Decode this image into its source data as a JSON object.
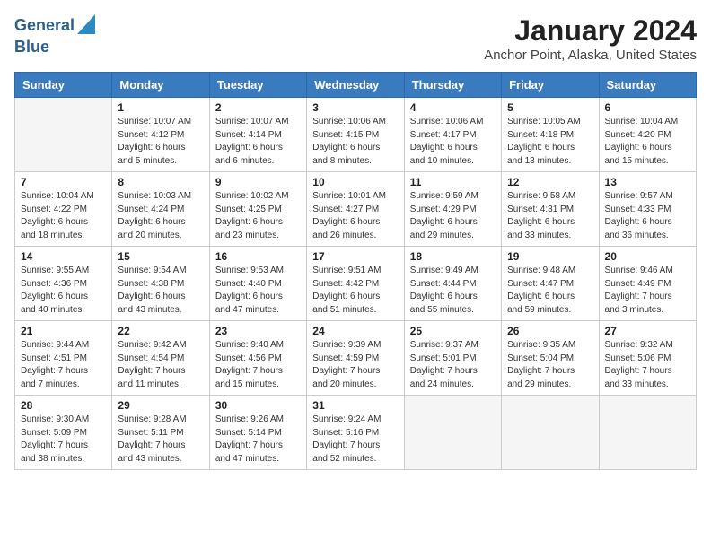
{
  "logo": {
    "line1": "General",
    "line2": "Blue"
  },
  "title": "January 2024",
  "subtitle": "Anchor Point, Alaska, United States",
  "headers": [
    "Sunday",
    "Monday",
    "Tuesday",
    "Wednesday",
    "Thursday",
    "Friday",
    "Saturday"
  ],
  "weeks": [
    [
      {
        "day": "",
        "info": ""
      },
      {
        "day": "1",
        "info": "Sunrise: 10:07 AM\nSunset: 4:12 PM\nDaylight: 6 hours\nand 5 minutes."
      },
      {
        "day": "2",
        "info": "Sunrise: 10:07 AM\nSunset: 4:14 PM\nDaylight: 6 hours\nand 6 minutes."
      },
      {
        "day": "3",
        "info": "Sunrise: 10:06 AM\nSunset: 4:15 PM\nDaylight: 6 hours\nand 8 minutes."
      },
      {
        "day": "4",
        "info": "Sunrise: 10:06 AM\nSunset: 4:17 PM\nDaylight: 6 hours\nand 10 minutes."
      },
      {
        "day": "5",
        "info": "Sunrise: 10:05 AM\nSunset: 4:18 PM\nDaylight: 6 hours\nand 13 minutes."
      },
      {
        "day": "6",
        "info": "Sunrise: 10:04 AM\nSunset: 4:20 PM\nDaylight: 6 hours\nand 15 minutes."
      }
    ],
    [
      {
        "day": "7",
        "info": "Sunrise: 10:04 AM\nSunset: 4:22 PM\nDaylight: 6 hours\nand 18 minutes."
      },
      {
        "day": "8",
        "info": "Sunrise: 10:03 AM\nSunset: 4:24 PM\nDaylight: 6 hours\nand 20 minutes."
      },
      {
        "day": "9",
        "info": "Sunrise: 10:02 AM\nSunset: 4:25 PM\nDaylight: 6 hours\nand 23 minutes."
      },
      {
        "day": "10",
        "info": "Sunrise: 10:01 AM\nSunset: 4:27 PM\nDaylight: 6 hours\nand 26 minutes."
      },
      {
        "day": "11",
        "info": "Sunrise: 9:59 AM\nSunset: 4:29 PM\nDaylight: 6 hours\nand 29 minutes."
      },
      {
        "day": "12",
        "info": "Sunrise: 9:58 AM\nSunset: 4:31 PM\nDaylight: 6 hours\nand 33 minutes."
      },
      {
        "day": "13",
        "info": "Sunrise: 9:57 AM\nSunset: 4:33 PM\nDaylight: 6 hours\nand 36 minutes."
      }
    ],
    [
      {
        "day": "14",
        "info": "Sunrise: 9:55 AM\nSunset: 4:36 PM\nDaylight: 6 hours\nand 40 minutes."
      },
      {
        "day": "15",
        "info": "Sunrise: 9:54 AM\nSunset: 4:38 PM\nDaylight: 6 hours\nand 43 minutes."
      },
      {
        "day": "16",
        "info": "Sunrise: 9:53 AM\nSunset: 4:40 PM\nDaylight: 6 hours\nand 47 minutes."
      },
      {
        "day": "17",
        "info": "Sunrise: 9:51 AM\nSunset: 4:42 PM\nDaylight: 6 hours\nand 51 minutes."
      },
      {
        "day": "18",
        "info": "Sunrise: 9:49 AM\nSunset: 4:44 PM\nDaylight: 6 hours\nand 55 minutes."
      },
      {
        "day": "19",
        "info": "Sunrise: 9:48 AM\nSunset: 4:47 PM\nDaylight: 6 hours\nand 59 minutes."
      },
      {
        "day": "20",
        "info": "Sunrise: 9:46 AM\nSunset: 4:49 PM\nDaylight: 7 hours\nand 3 minutes."
      }
    ],
    [
      {
        "day": "21",
        "info": "Sunrise: 9:44 AM\nSunset: 4:51 PM\nDaylight: 7 hours\nand 7 minutes."
      },
      {
        "day": "22",
        "info": "Sunrise: 9:42 AM\nSunset: 4:54 PM\nDaylight: 7 hours\nand 11 minutes."
      },
      {
        "day": "23",
        "info": "Sunrise: 9:40 AM\nSunset: 4:56 PM\nDaylight: 7 hours\nand 15 minutes."
      },
      {
        "day": "24",
        "info": "Sunrise: 9:39 AM\nSunset: 4:59 PM\nDaylight: 7 hours\nand 20 minutes."
      },
      {
        "day": "25",
        "info": "Sunrise: 9:37 AM\nSunset: 5:01 PM\nDaylight: 7 hours\nand 24 minutes."
      },
      {
        "day": "26",
        "info": "Sunrise: 9:35 AM\nSunset: 5:04 PM\nDaylight: 7 hours\nand 29 minutes."
      },
      {
        "day": "27",
        "info": "Sunrise: 9:32 AM\nSunset: 5:06 PM\nDaylight: 7 hours\nand 33 minutes."
      }
    ],
    [
      {
        "day": "28",
        "info": "Sunrise: 9:30 AM\nSunset: 5:09 PM\nDaylight: 7 hours\nand 38 minutes."
      },
      {
        "day": "29",
        "info": "Sunrise: 9:28 AM\nSunset: 5:11 PM\nDaylight: 7 hours\nand 43 minutes."
      },
      {
        "day": "30",
        "info": "Sunrise: 9:26 AM\nSunset: 5:14 PM\nDaylight: 7 hours\nand 47 minutes."
      },
      {
        "day": "31",
        "info": "Sunrise: 9:24 AM\nSunset: 5:16 PM\nDaylight: 7 hours\nand 52 minutes."
      },
      {
        "day": "",
        "info": ""
      },
      {
        "day": "",
        "info": ""
      },
      {
        "day": "",
        "info": ""
      }
    ]
  ]
}
